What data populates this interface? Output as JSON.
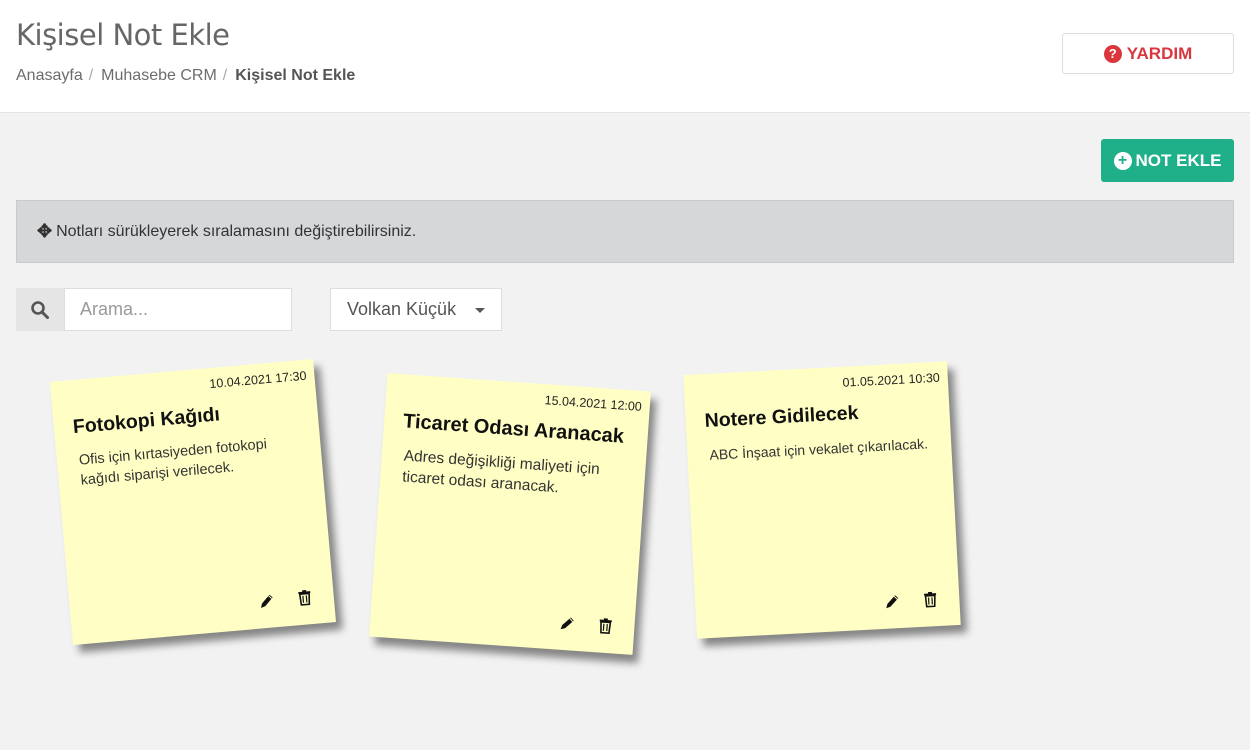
{
  "header": {
    "title": "Kişisel Not Ekle",
    "breadcrumb": [
      "Anasayfa",
      "Muhasebe CRM",
      "Kişisel Not Ekle"
    ],
    "help_label": "YARDIM"
  },
  "toolbar": {
    "add_label": "NOT EKLE"
  },
  "info": {
    "text": "Notları sürükleyerek sıralamasını değiştirebilirsiniz."
  },
  "search": {
    "placeholder": "Arama...",
    "value": ""
  },
  "user_filter": {
    "selected": "Volkan Küçük"
  },
  "notes": [
    {
      "date": "10.04.2021 17:30",
      "title": "Fotokopi Kağıdı",
      "body": "Ofis için kırtasiyeden fotokopi kağıdı siparişi verilecek."
    },
    {
      "date": "15.04.2021 12:00",
      "title": "Ticaret Odası Aranacak",
      "body": "Adres değişikliği maliyeti için ticaret odası aranacak."
    },
    {
      "date": "01.05.2021 10:30",
      "title": "Notere Gidilecek",
      "body": "ABC İnşaat için vekalet çıkarılacak."
    }
  ],
  "icons": {
    "help": "question-circle-icon",
    "add": "plus-circle-icon",
    "move": "arrows-move-icon",
    "search": "search-icon",
    "edit": "pencil-icon",
    "delete": "trash-icon"
  },
  "colors": {
    "accent_green": "#1fb08a",
    "help_red": "#d9363e",
    "note_yellow": "#ffffc5"
  }
}
